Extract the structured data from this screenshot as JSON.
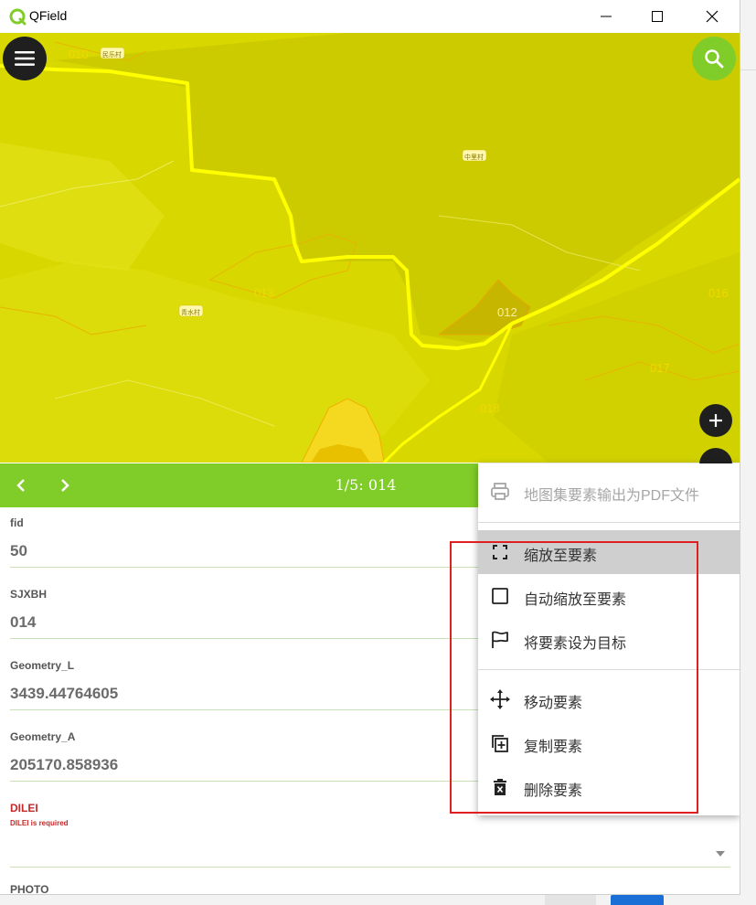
{
  "window": {
    "app_title": "QField"
  },
  "map": {
    "parcel_labels": [
      "010",
      "013",
      "012",
      "016",
      "017",
      "018"
    ],
    "village_labels": [
      "民乐村",
      "中里村",
      "青水村"
    ]
  },
  "feature_nav": {
    "title": "1/5: 014"
  },
  "form": {
    "fields": [
      {
        "label": "fid",
        "value": "50"
      },
      {
        "label": "SJXBH",
        "value": "014"
      },
      {
        "label": "Geometry_L",
        "value": "3439.44764605"
      },
      {
        "label": "Geometry_A",
        "value": "205170.858936"
      }
    ],
    "dilei": {
      "label": "DILEI",
      "note": "DILEI is required",
      "value": ""
    },
    "photo": {
      "label": "PHOTO"
    }
  },
  "menu": {
    "items": [
      {
        "label": "地图集要素输出为PDF文件",
        "icon": "printer-icon",
        "disabled": true
      },
      {
        "label": "缩放至要素",
        "icon": "zoom-to-feature-icon",
        "active": true
      },
      {
        "label": "自动缩放至要素",
        "icon": "checkbox-icon"
      },
      {
        "label": "将要素设为目标",
        "icon": "flag-icon"
      },
      {
        "label": "移动要素",
        "icon": "move-icon"
      },
      {
        "label": "复制要素",
        "icon": "duplicate-icon"
      },
      {
        "label": "删除要素",
        "icon": "delete-icon"
      }
    ]
  },
  "colors": {
    "accent": "#80cc28",
    "map_fill": "#d8d800",
    "boundary": "#ffff00",
    "highlight": "#e02020",
    "required": "#c62828"
  }
}
